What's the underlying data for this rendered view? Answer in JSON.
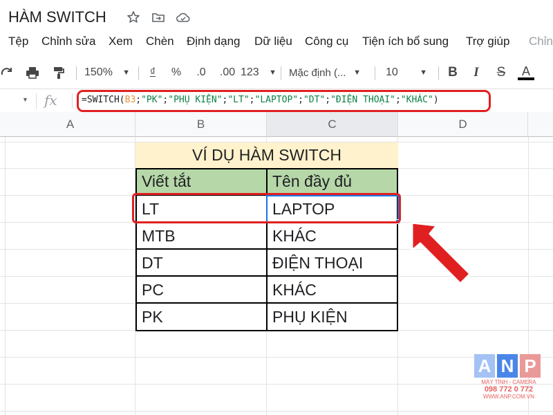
{
  "doc": {
    "title": "HÀM SWITCH",
    "icons": [
      "star-icon",
      "move-to-folder-icon",
      "cloud-status-icon"
    ]
  },
  "menu": {
    "items": [
      "Tệp",
      "Chỉnh sửa",
      "Xem",
      "Chèn",
      "Định dạng",
      "Dữ liệu",
      "Công cụ",
      "Tiện ích bổ sung",
      "Trợ giúp",
      "Chỉn"
    ]
  },
  "toolbar": {
    "zoom": "150%",
    "currency": "₫",
    "percent": "%",
    "decrease_decimals": ".0",
    "increase_decimals": ".00",
    "more_formats": "123",
    "font": "Mặc định (...",
    "font_size": "10",
    "bold": "B",
    "italic": "I",
    "strikethrough": "S",
    "text_color": "A"
  },
  "formula_bar": {
    "fx_label": "fx",
    "parts": [
      {
        "text": "=SWITCH(",
        "color": "#202124"
      },
      {
        "text": "B3",
        "color": "#e69138"
      },
      {
        "text": ";",
        "color": "#202124"
      },
      {
        "text": "\"PK\"",
        "color": "#0b8043"
      },
      {
        "text": ";",
        "color": "#202124"
      },
      {
        "text": "\"PHỤ KIỆN\"",
        "color": "#0b8043"
      },
      {
        "text": ";",
        "color": "#202124"
      },
      {
        "text": "\"LT\"",
        "color": "#0b8043"
      },
      {
        "text": ";",
        "color": "#202124"
      },
      {
        "text": "\"LAPTOP\"",
        "color": "#0b8043"
      },
      {
        "text": ";",
        "color": "#202124"
      },
      {
        "text": "\"DT\"",
        "color": "#0b8043"
      },
      {
        "text": ";",
        "color": "#202124"
      },
      {
        "text": "\"ĐIỆN THOẠI\"",
        "color": "#0b8043"
      },
      {
        "text": ";",
        "color": "#202124"
      },
      {
        "text": "\"KHÁC\"",
        "color": "#0b8043"
      },
      {
        "text": ")",
        "color": "#202124"
      }
    ]
  },
  "sheet": {
    "columns": [
      "A",
      "B",
      "C",
      "D"
    ],
    "table_title": "VÍ DỤ HÀM SWITCH",
    "headers": [
      "Viết tắt",
      "Tên đầy đủ"
    ],
    "rows": [
      [
        "LT",
        "LAPTOP"
      ],
      [
        "MTB",
        "KHÁC"
      ],
      [
        "DT",
        "ĐIỆN THOẠI"
      ],
      [
        "PC",
        "KHÁC"
      ],
      [
        "PK",
        "PHỤ KIỆN"
      ]
    ]
  },
  "colors": {
    "title_fill": "#fff2cc",
    "header_fill": "#b6d7a8",
    "annotation_red": "#e02020",
    "selection_blue": "#1a73e8"
  },
  "watermark": {
    "letters": [
      "A",
      "N",
      "P"
    ],
    "letter_colors": [
      "#a4c2f4",
      "#4a86e8",
      "#ea9999"
    ],
    "tagline": "MÁY TÍNH - CAMERA",
    "phone": "098 772 0 772",
    "url": "WWW.ANP.COM.VN"
  }
}
